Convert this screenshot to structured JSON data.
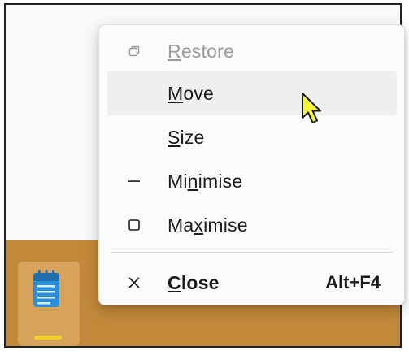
{
  "menu": {
    "items": [
      {
        "id": "restore",
        "label": "Restore",
        "mnemonic_index": 0,
        "icon": "restore-icon",
        "disabled": true
      },
      {
        "id": "move",
        "label": "Move",
        "mnemonic_index": 0,
        "icon": "",
        "hover": true
      },
      {
        "id": "size",
        "label": "Size",
        "mnemonic_index": 0,
        "icon": ""
      },
      {
        "id": "minimise",
        "label": "Minimise",
        "mnemonic_index": 2,
        "icon": "minimize-icon"
      },
      {
        "id": "maximise",
        "label": "Maximise",
        "mnemonic_index": 2,
        "icon": "maximize-icon"
      },
      {
        "id": "close",
        "label": "Close",
        "mnemonic_index": 0,
        "icon": "close-icon",
        "bold": true,
        "shortcut": "Alt+F4"
      }
    ]
  },
  "taskbar": {
    "app_icon": "notepad-icon"
  },
  "colors": {
    "taskbar": "#c2893a",
    "indicator": "#f3d02b",
    "hover": "#efefef",
    "cursor": "#f5f53a"
  }
}
